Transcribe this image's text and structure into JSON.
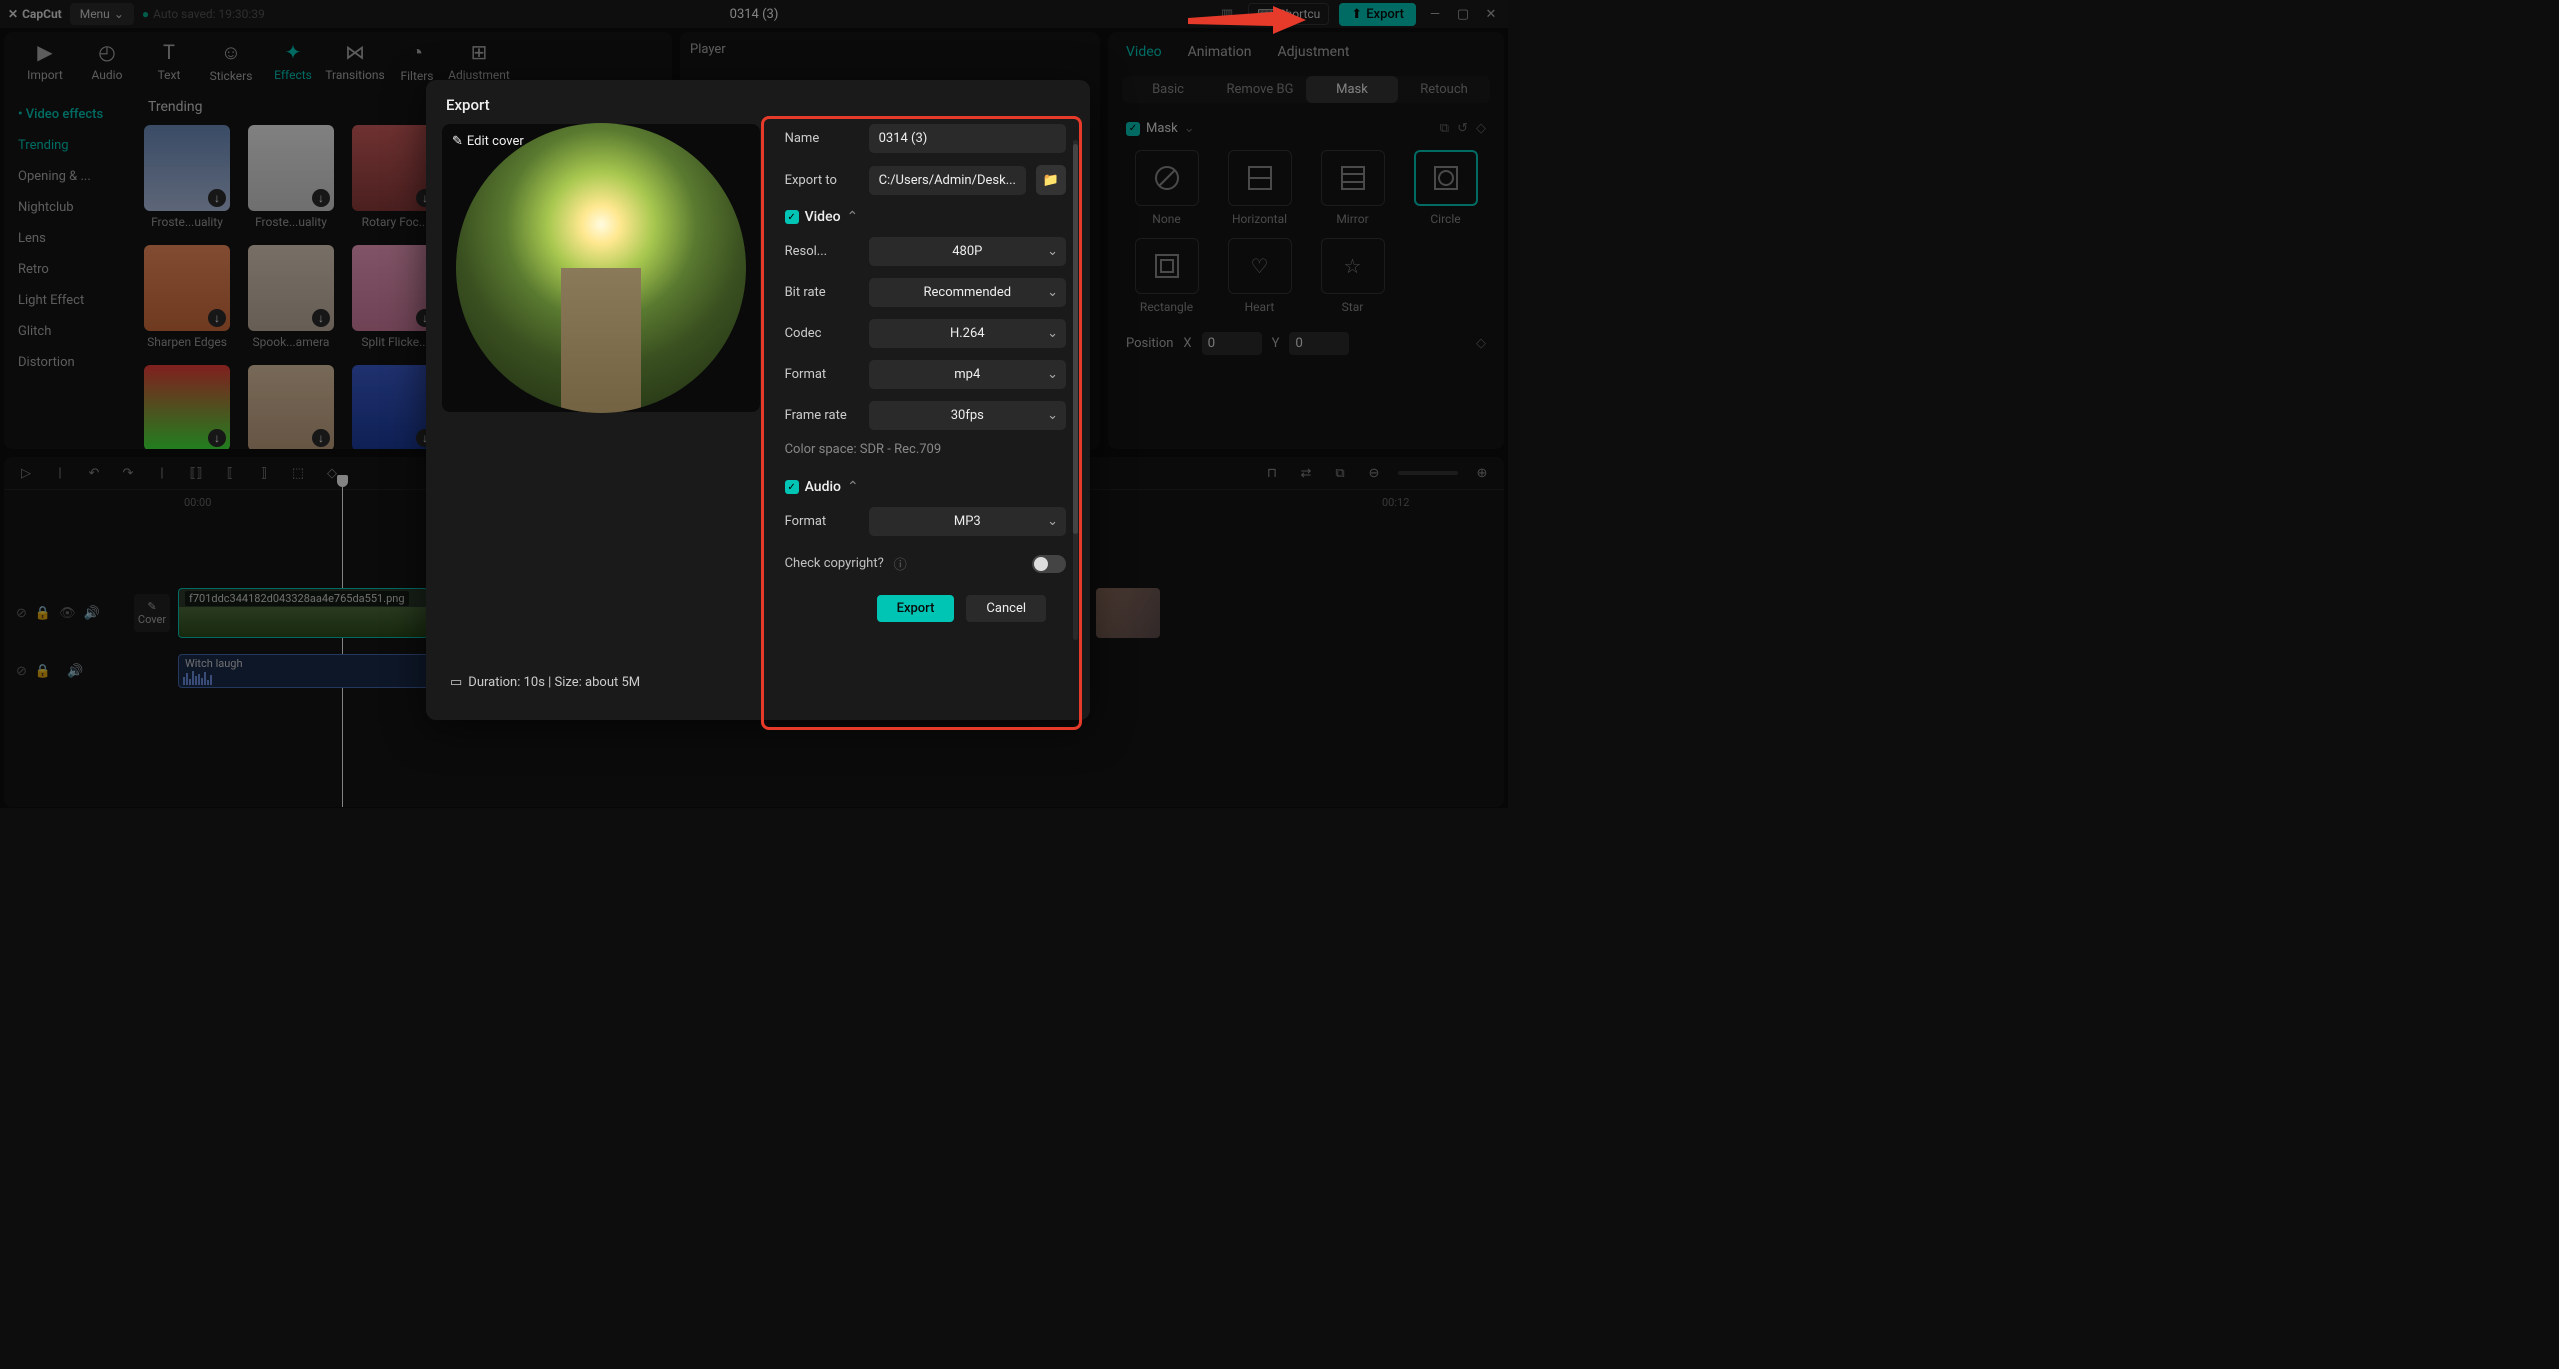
{
  "titlebar": {
    "logo": "CapCut",
    "menu": "Menu",
    "autosave": "Auto saved: 19:30:39",
    "project_title": "0314 (3)",
    "shortcut": "Shortcu",
    "export": "Export"
  },
  "tool_tabs": [
    "Import",
    "Audio",
    "Text",
    "Stickers",
    "Effects",
    "Transitions",
    "Filters",
    "Adjustment"
  ],
  "effects_sidebar": {
    "header": "Video effects",
    "items": [
      "Trending",
      "Opening & ...",
      "Nightclub",
      "Lens",
      "Retro",
      "Light Effect",
      "Glitch",
      "Distortion"
    ]
  },
  "effects_grid": {
    "title": "Trending",
    "items": [
      "Froste...uality",
      "Froste...uality",
      "Rotary Foc...",
      "",
      "Sharpen Edges",
      "Spook...amera",
      "Split Flicke...",
      "",
      "",
      "",
      "",
      ""
    ]
  },
  "player": {
    "title": "Player"
  },
  "right_panel": {
    "tabs": [
      "Video",
      "Animation",
      "Adjustment"
    ],
    "subtabs": [
      "Basic",
      "Remove BG",
      "Mask",
      "Retouch"
    ],
    "mask_label": "Mask",
    "masks": [
      "None",
      "Horizontal",
      "Mirror",
      "Circle",
      "Rectangle",
      "Heart",
      "Star"
    ],
    "position_label": "Position",
    "position_x": "X",
    "position_x_val": "0",
    "position_y": "Y",
    "position_y_val": "0"
  },
  "timeline": {
    "ticks": [
      "00:00",
      "00:12"
    ],
    "clip_name": "f701ddc344182d043328aa4e765da551.png",
    "audio_name": "Witch laugh",
    "cover": "Cover"
  },
  "export_dialog": {
    "title": "Export",
    "edit_cover": "Edit cover",
    "name_label": "Name",
    "name_value": "0314 (3)",
    "exportto_label": "Export to",
    "exportto_value": "C:/Users/Admin/Desk...",
    "video_section": "Video",
    "resolution_label": "Resol...",
    "resolution_value": "480P",
    "bitrate_label": "Bit rate",
    "bitrate_value": "Recommended",
    "codec_label": "Codec",
    "codec_value": "H.264",
    "format_label": "Format",
    "format_value": "mp4",
    "framerate_label": "Frame rate",
    "framerate_value": "30fps",
    "colorspace": "Color space: SDR - Rec.709",
    "audio_section": "Audio",
    "audio_format_label": "Format",
    "audio_format_value": "MP3",
    "copyright_label": "Check copyright?",
    "duration": "Duration: 10s | Size: about 5M",
    "export_btn": "Export",
    "cancel_btn": "Cancel"
  }
}
